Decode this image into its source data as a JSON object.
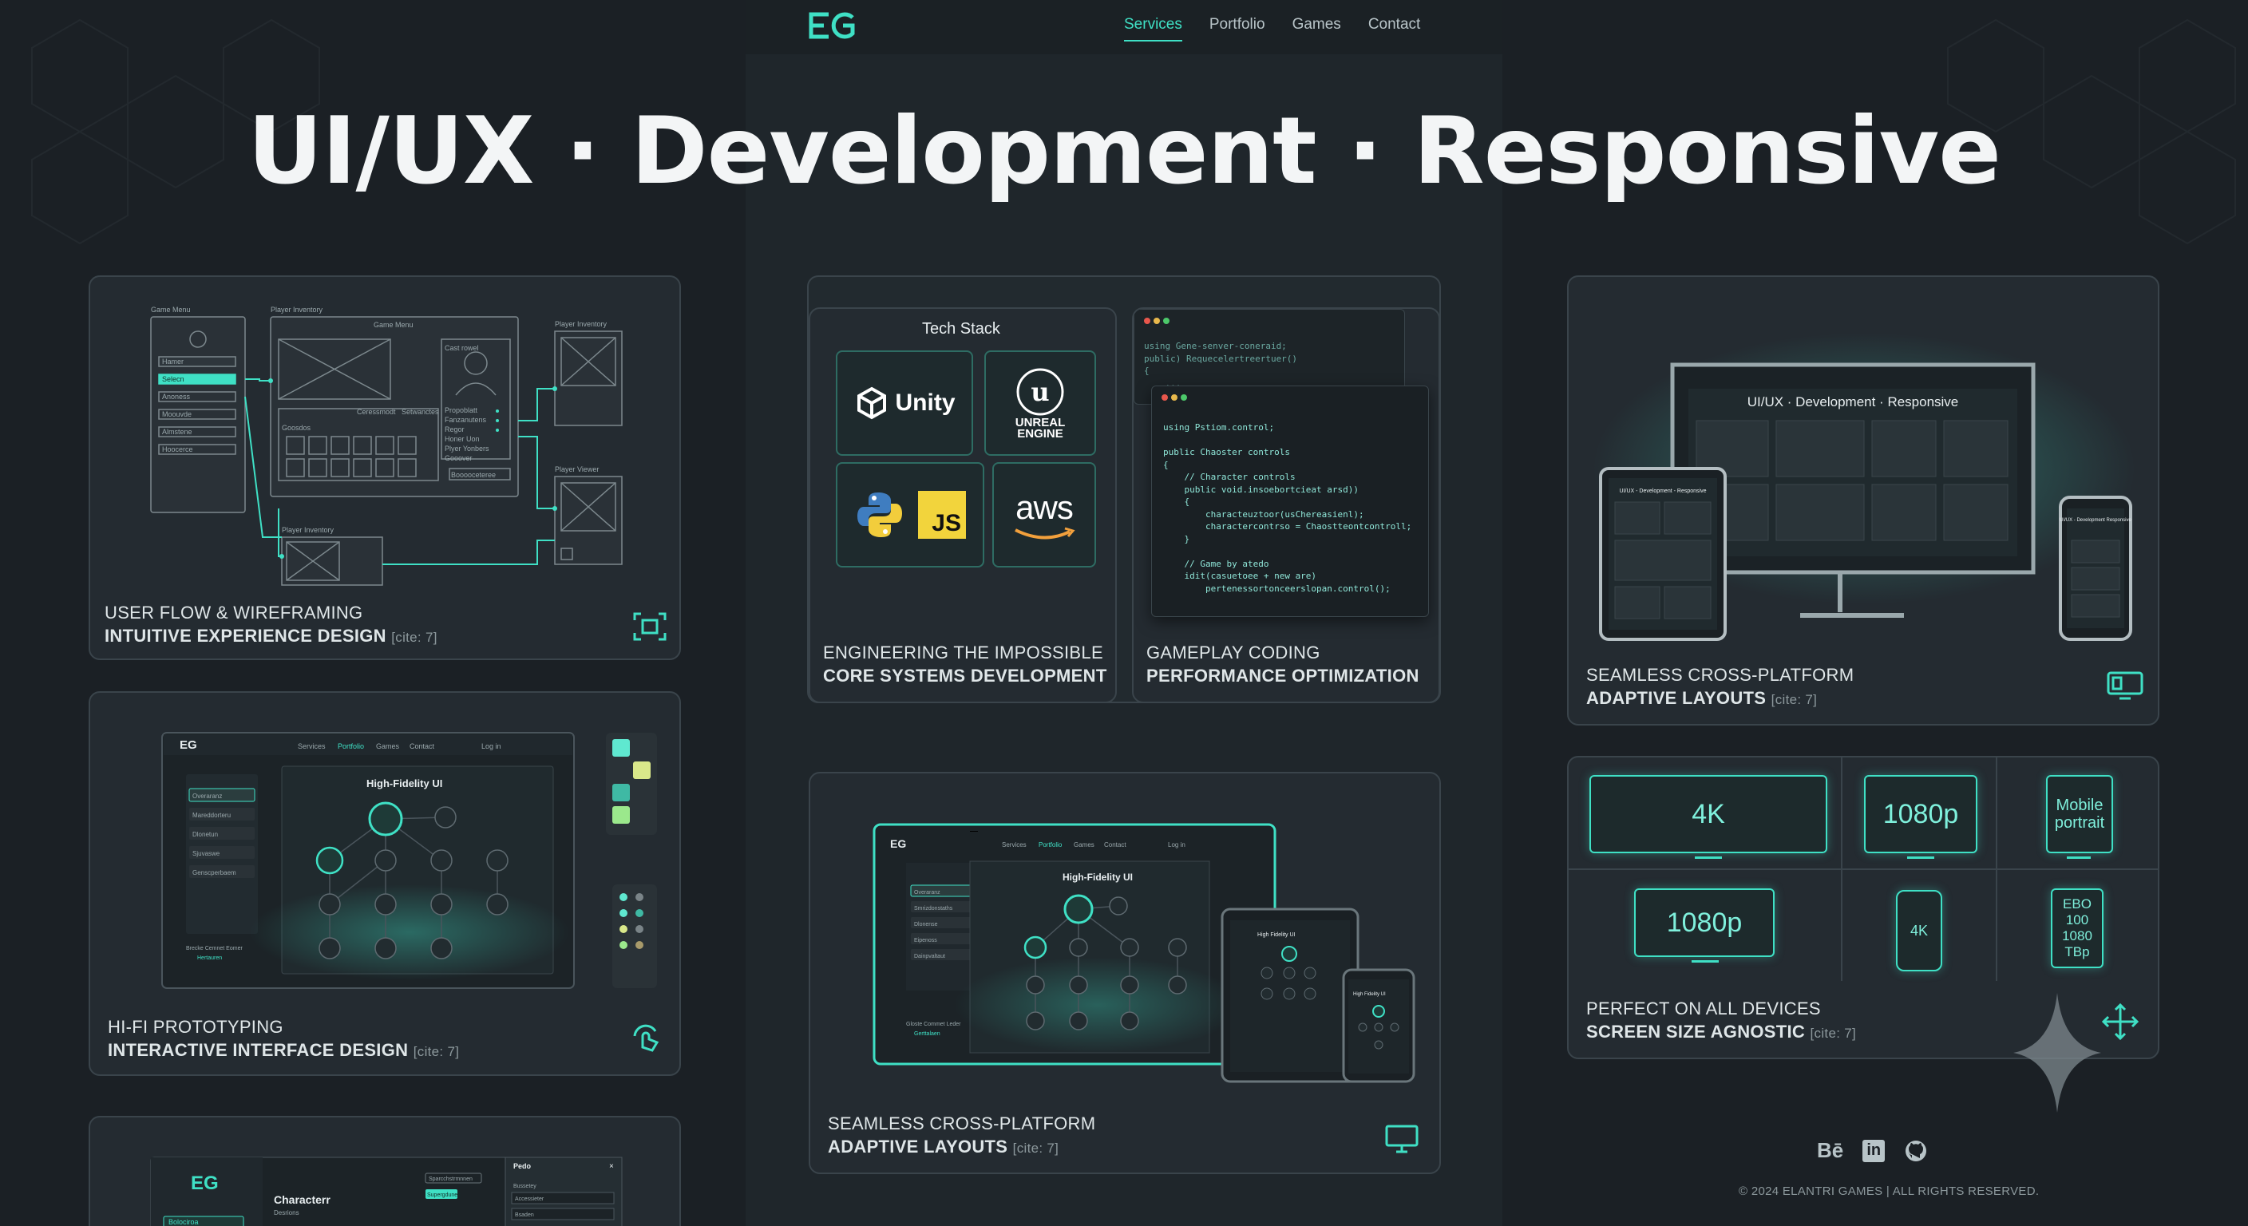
{
  "nav": {
    "logo": "EG",
    "links": [
      "Services",
      "Portfolio",
      "Games",
      "Contact"
    ],
    "active": "Services"
  },
  "headline": "UI/UX · Development · Responsive",
  "cards": {
    "wireframe": {
      "line1": "USER FLOW & WIREFRAMING",
      "line2": "INTUITIVE EXPERIENCE DESIGN",
      "cite": "[cite: 7]",
      "labels": {
        "game_menu": "Game Menu",
        "player_inventory": "Player Inventory",
        "game_menu_title": "Game Menu",
        "player_inventory_r": "Player Inventory",
        "player_viewer": "Player Viewer",
        "player_inventory_b": "Player Inventory",
        "menu_items": [
          "Hamer",
          "Selecn",
          "Anoness",
          "Moouvde",
          "Almstene",
          "Hoocerce"
        ],
        "side_items": [
          "Propoblatt",
          "Fanzanutens",
          "Regor",
          "Honer Uon",
          "Plyer Yonbers",
          "Gooover"
        ],
        "btns": [
          "Ceressmodt",
          "Setwanctes"
        ],
        "goosdos": "Goosdos",
        "bocsccteceo": "Booooceteree",
        "card_name": "Cast rowel"
      }
    },
    "hifi": {
      "line1": "HI-FI PROTOTYPING",
      "line2": "INTERACTIVE INTERFACE DESIGN",
      "cite": "[cite: 7]",
      "screen_title": "High-Fidelity UI",
      "logo": "EG",
      "menu": [
        "Services",
        "Portfolio",
        "Games",
        "Contact"
      ],
      "login": "Log in",
      "sidebar": [
        "Overaranz",
        "Mareddorteru",
        "Dlonetun",
        "Sjuvaswe",
        "Genscperbaem"
      ],
      "footer_label": "Brecke Cemnet Eomer",
      "footer_value": "Hertauren"
    },
    "bottom_partial": {
      "logo": "EG",
      "title": "Characterr",
      "subtitle": "Desrions",
      "btn": "Sparcchstrmnnen",
      "tag": "Supergdunelt",
      "side": "Bolociroa",
      "panel_title": "Pedo",
      "panel_items": [
        "Bussetey",
        "Accessieter",
        "Bsaden"
      ]
    },
    "techstack": {
      "title": "Tech Stack",
      "tiles": [
        "Unity",
        "UNREAL ENGINE",
        "Python",
        "JS",
        "aws"
      ],
      "line1": "ENGINEERING THE IMPOSSIBLE",
      "line2": "CORE SYSTEMS DEVELOPMENT"
    },
    "gameplay": {
      "line1": "GAMEPLAY CODING",
      "line2": "PERFORMANCE OPTIMIZATION",
      "code_back": "using Gene-senver-coneraid;\npublic) Requecelertreertuer()\n{\n    ...",
      "code_front": "using Pstiom.control;\n\npublic Chaoster controls\n{\n    // Character controls\n    public void.insoebortcieat arsd))\n    {\n        characteuztoor(usChereasienl);\n        charactercontrso = Chaostteontcontroll;\n    }\n\n    // Game by atedo\n    idit(casuetoee + new are)\n        pertenessortonceerslopan.control();"
    },
    "crossplatform_center": {
      "line1": "SEAMLESS CROSS-PLATFORM",
      "line2": "ADAPTIVE LAYOUTS",
      "cite": "[cite: 7]",
      "screen_title": "High-Fidelity UI",
      "logo": "EG",
      "menu": [
        "Services",
        "Portfolio",
        "Games",
        "Contact"
      ],
      "login": "Log in",
      "sidebar": [
        "Overaranz",
        "Smrizdonstaths",
        "Dlonense",
        "Eipenoss",
        "Dainpvaltaut"
      ],
      "footer_label": "Gloste Commet Leder",
      "footer_value": "Gerttalaen",
      "tablet_title": "High Fidelity UI",
      "phone_title": "High Fidelity UI"
    },
    "crossplatform_right": {
      "line1": "SEAMLESS CROSS-PLATFORM",
      "line2": "ADAPTIVE LAYOUTS",
      "cite": "[cite: 7]",
      "monitor_title": "UI/UX · Development · Responsive",
      "tablet_title": "UI/UX - Development - Responsive",
      "phone_title": "UI/UX - Development Responsive"
    },
    "devices": {
      "line1": "PERFECT ON ALL DEVICES",
      "line2": "SCREEN SIZE AGNOSTIC",
      "cite": "[cite: 7]",
      "cells": [
        "4K",
        "1080p",
        "Mobile portrait",
        "1080p",
        "4K",
        "EBO 100 1080 TBp"
      ]
    }
  },
  "footer": {
    "social": [
      "Bē",
      "in",
      "github"
    ],
    "copyright": "© 2024 ELANTRI GAMES | ALL RIGHTS RESERVED."
  },
  "colors": {
    "accent": "#3fe0c5",
    "background": "#1b2025",
    "card": "#242b31",
    "card_border": "#3a444b"
  }
}
